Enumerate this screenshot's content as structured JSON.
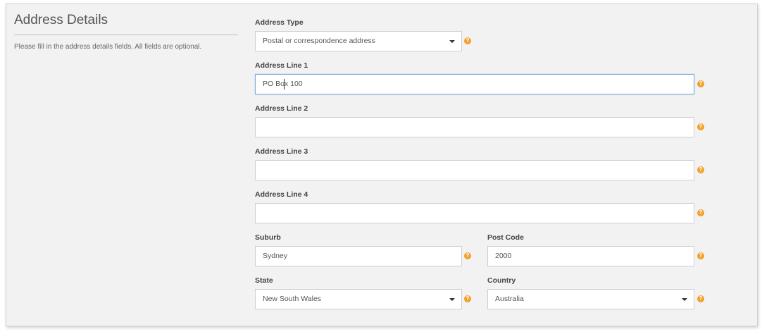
{
  "section": {
    "title": "Address Details",
    "description": "Please fill in the address details fields. All fields are optional."
  },
  "fields": {
    "address_type": {
      "label": "Address Type",
      "value": "Postal or correspondence address"
    },
    "address_line_1": {
      "label": "Address Line 1",
      "value": "PO Box 100"
    },
    "address_line_2": {
      "label": "Address Line 2",
      "value": ""
    },
    "address_line_3": {
      "label": "Address Line 3",
      "value": ""
    },
    "address_line_4": {
      "label": "Address Line 4",
      "value": ""
    },
    "suburb": {
      "label": "Suburb",
      "value": "Sydney"
    },
    "post_code": {
      "label": "Post Code",
      "value": "2000"
    },
    "state": {
      "label": "State",
      "value": "New South Wales"
    },
    "country": {
      "label": "Country",
      "value": "Australia"
    }
  },
  "help_icon": {
    "name": "question-circle-icon",
    "glyph": "?",
    "color": "#f0a22a"
  },
  "colors": {
    "panel_bg": "#f2f2f2",
    "focus_border": "#7fa9d8"
  }
}
